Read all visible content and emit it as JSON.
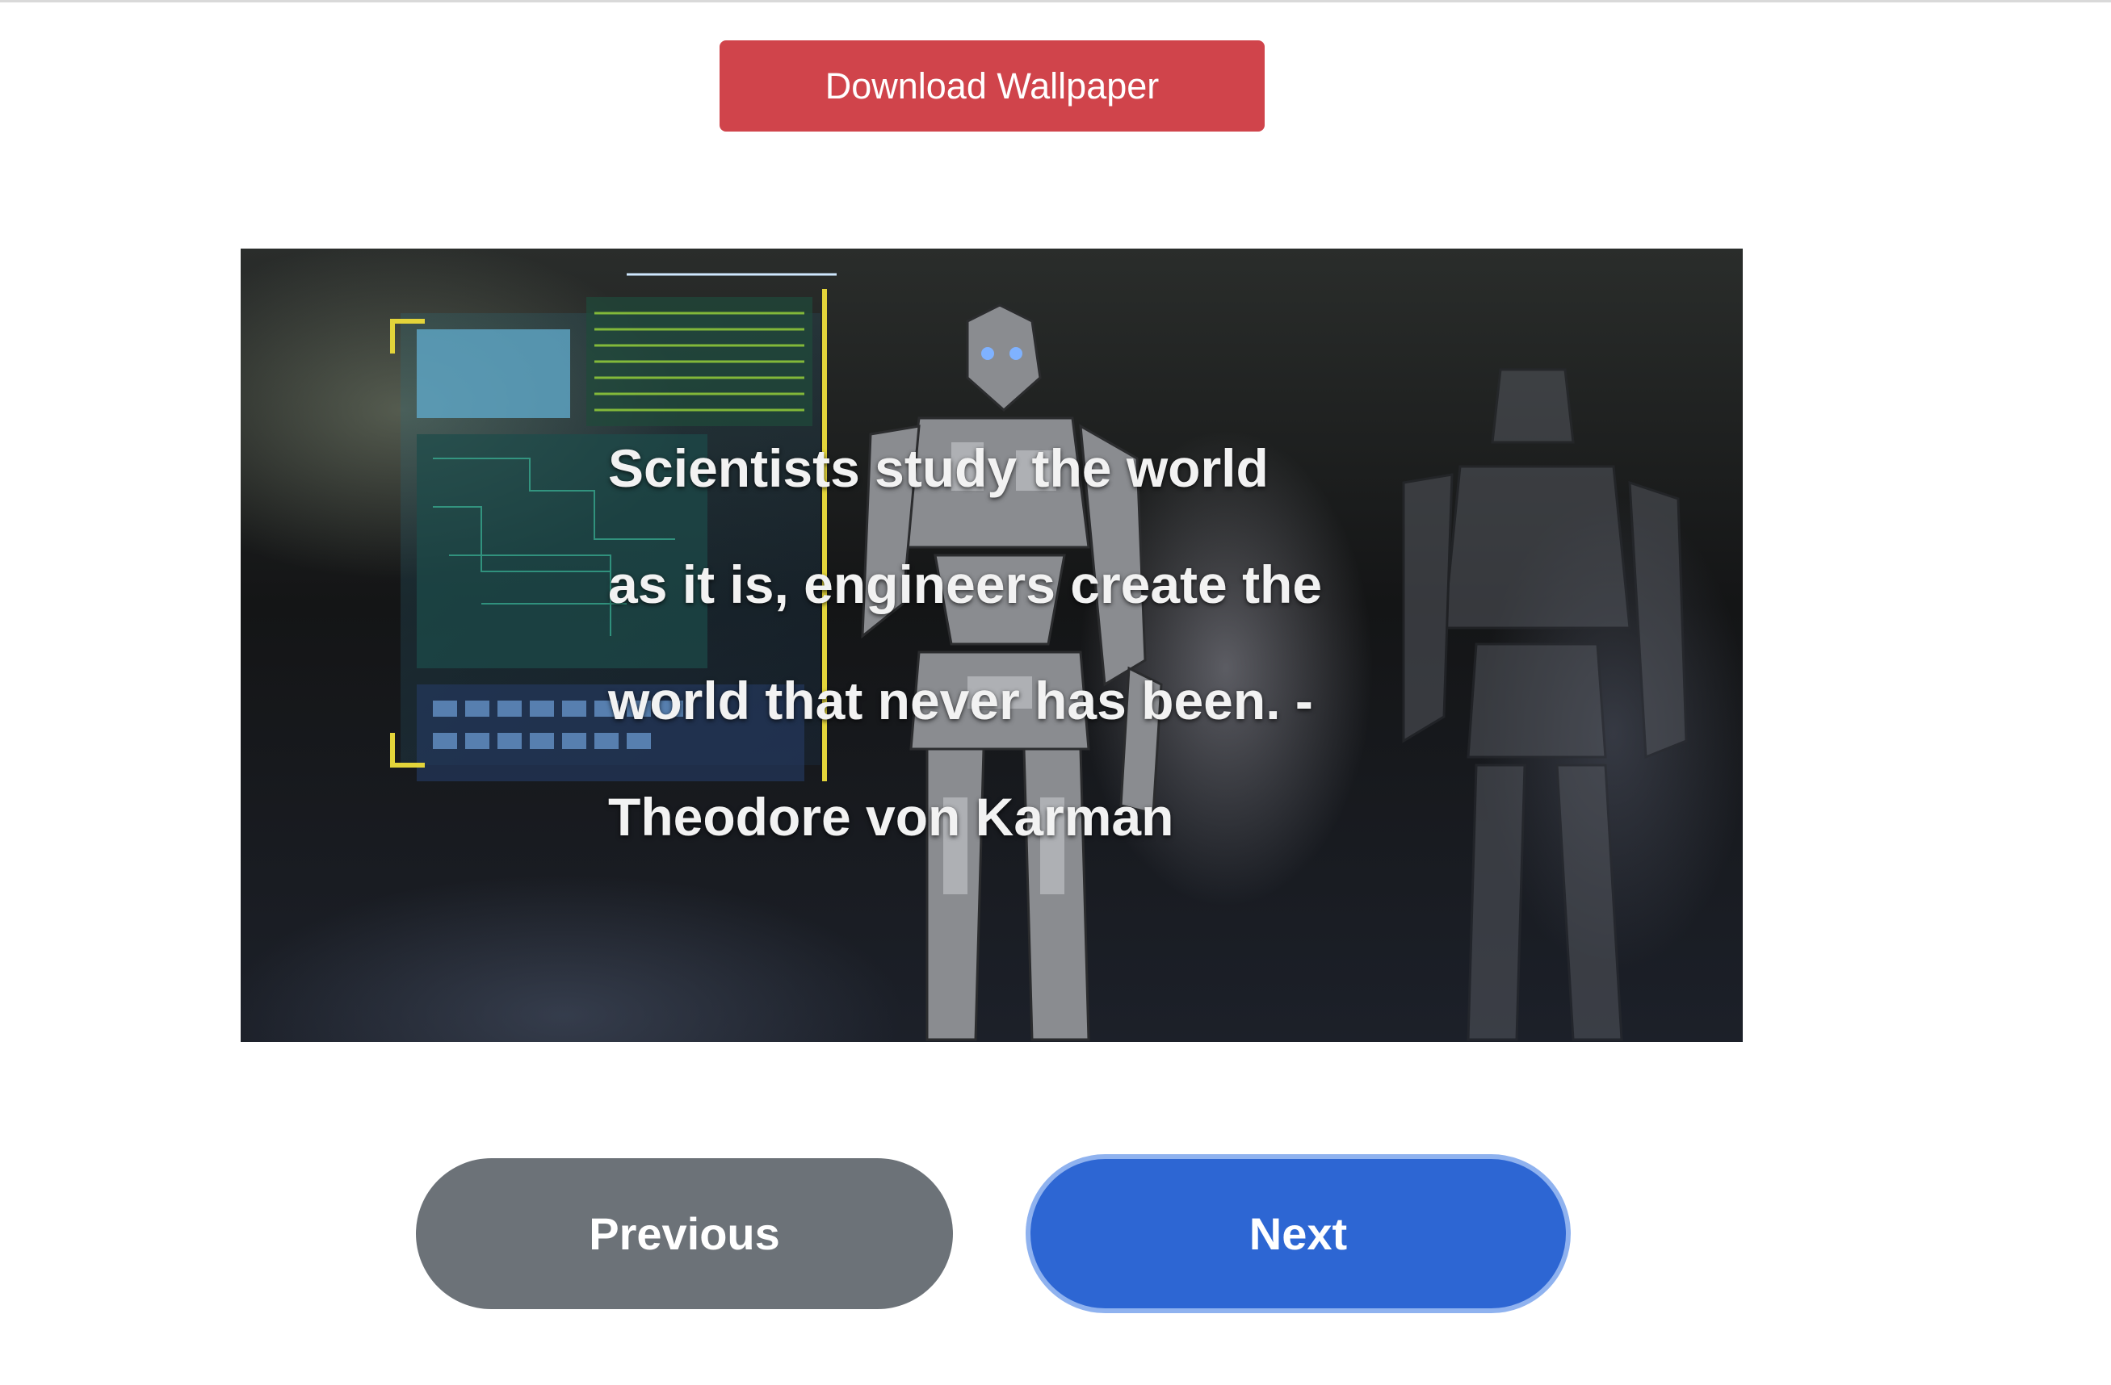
{
  "toolbar": {
    "download_label": "Download Wallpaper",
    "download_color": "#d0444b"
  },
  "wallpaper": {
    "quote_lines": [
      "Scientists study the world",
      "as it is, engineers create the",
      "world that never has been. -",
      "Theodore von Karman"
    ]
  },
  "navigation": {
    "previous_label": "Previous",
    "next_label": "Next",
    "previous_color": "#6c7278",
    "next_color": "#2d66d3"
  }
}
